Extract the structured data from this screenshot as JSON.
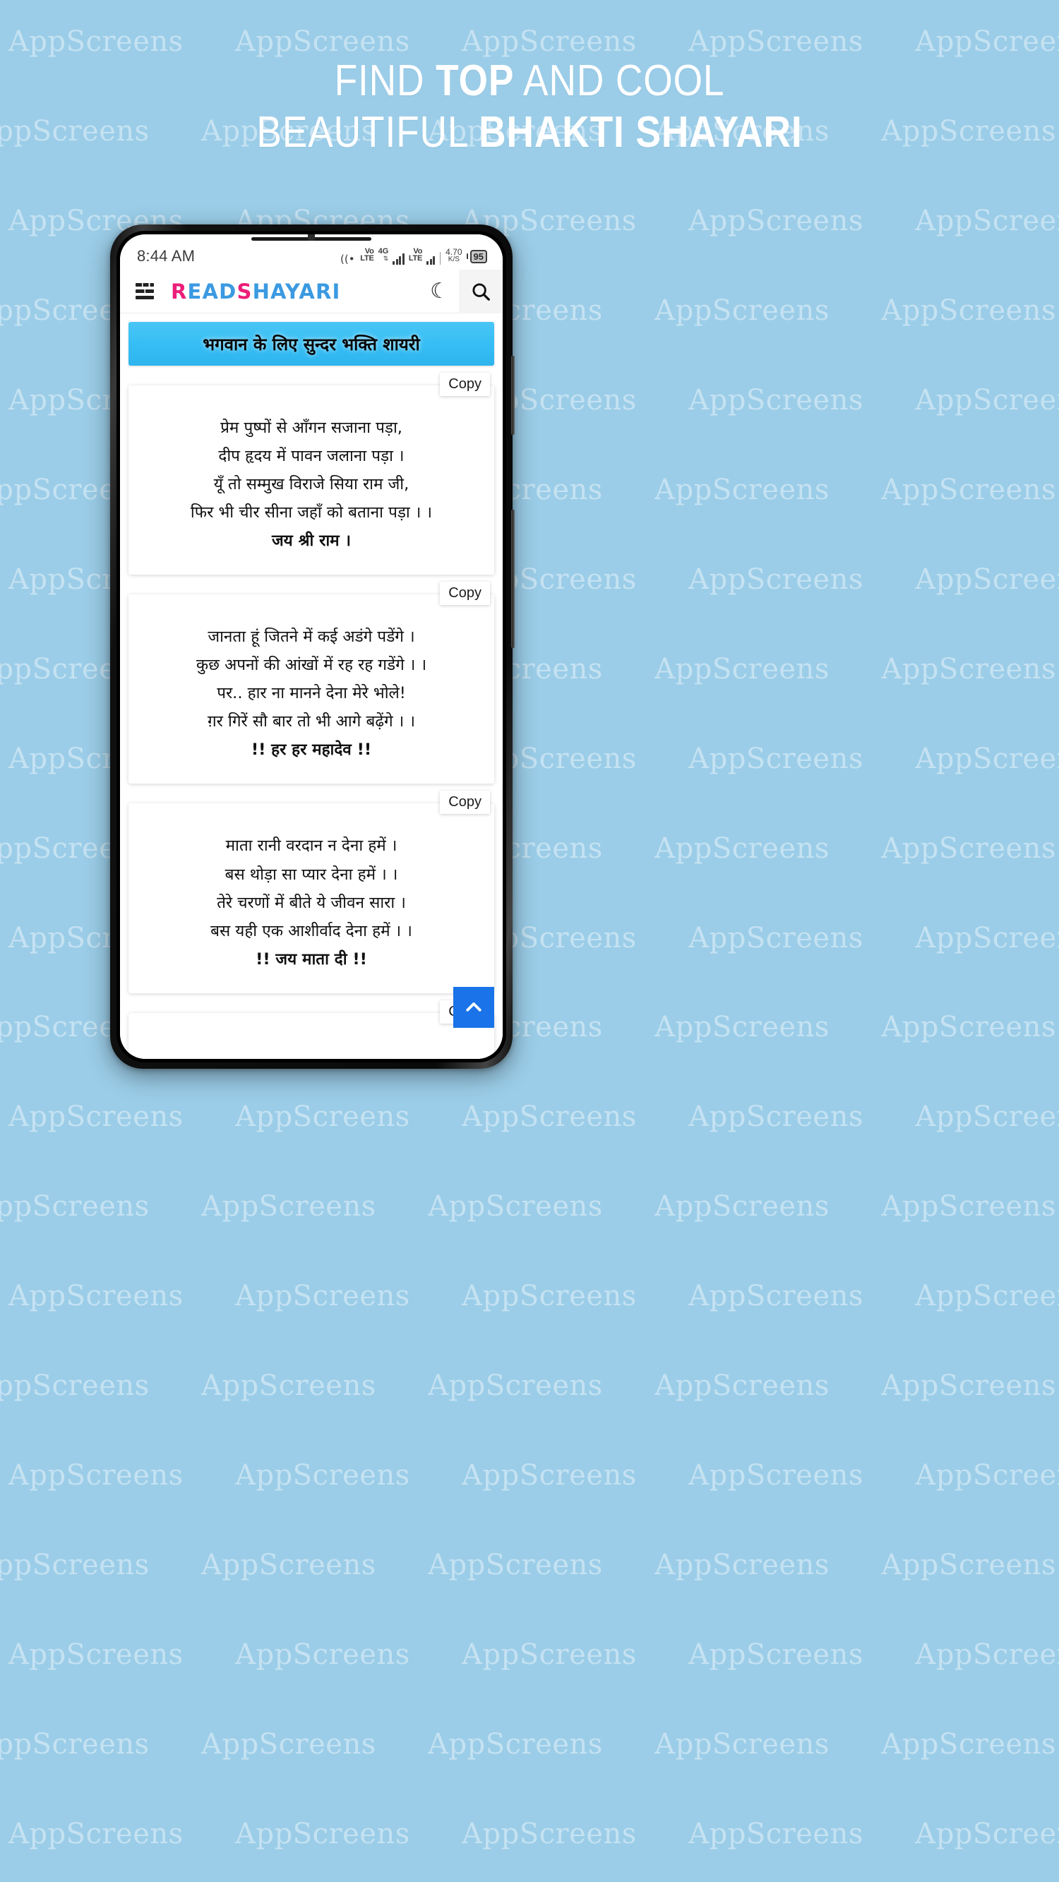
{
  "background": {
    "color": "#9bcde8",
    "watermark_text": "AppScreens"
  },
  "headline": {
    "line1_prefix": "FIND ",
    "line1_bold": "TOP",
    "line1_suffix": " AND COOL",
    "line2_prefix": "BEAUTIFUL ",
    "line2_bold": "BHAKTI SHAYARI"
  },
  "phone": {
    "status_bar": {
      "time": "8:44 AM",
      "volte_1": "Vo",
      "volte_1b": "LTE",
      "network": "4G",
      "volte_2": "Vo",
      "volte_2b": "LTE",
      "data_speed_value": "4.70",
      "data_speed_unit": "K/S",
      "battery_percent": "95"
    },
    "app_header": {
      "menu_icon": "hamburger-icon",
      "brand_r": "R",
      "brand_ead": "EAD ",
      "brand_s": "S",
      "brand_hayari": "HAYARI",
      "theme_icon": "moon-icon",
      "search_icon": "search-icon",
      "brand_pink": "#ec1e79",
      "brand_blue": "#3b9ae1"
    },
    "banner": {
      "title": "भगवान के लिए सुन्दर भक्ति शायरी",
      "color": "#35bdf4"
    },
    "copy_label": "Copy",
    "cards": [
      {
        "copy_label": "Copy",
        "lines": [
          "प्रेम पुष्पों से आँगन सजाना पड़ा,",
          "दीप हृदय में पावन जलाना पड़ा ।",
          "यूँ तो सम्मुख विराजे सिया राम जी,",
          "फिर भी चीर सीना जहाँ को बताना पड़ा । ।"
        ],
        "signature": "जय श्री राम ।"
      },
      {
        "copy_label": "Copy",
        "lines": [
          "जानता हूं जितने में कई अडंगे पडेंगे ।",
          "कुछ अपनों की आंखों में रह रह गडेंगे । ।",
          "पर.. हार ना मानने देना मेरे भोले!",
          "ग़र गिरें सौ बार तो भी आगे बढ़ेंगे । ।"
        ],
        "signature": "!! हर हर महादेव !!"
      },
      {
        "copy_label": "Copy",
        "lines": [
          "माता रानी वरदान न देना हमें ।",
          "बस थोड़ा सा प्यार देना हमें । ।",
          "तेरे चरणों में बीते ये जीवन सारा ।",
          "बस यही एक आशीर्वाद देना हमें । ।"
        ],
        "signature": "!! जय माता दी !!"
      }
    ],
    "partial_card": {
      "copy_label": "Copy"
    },
    "scroll_top": {
      "icon": "chevron-up-icon",
      "color": "#1a73e8"
    }
  }
}
